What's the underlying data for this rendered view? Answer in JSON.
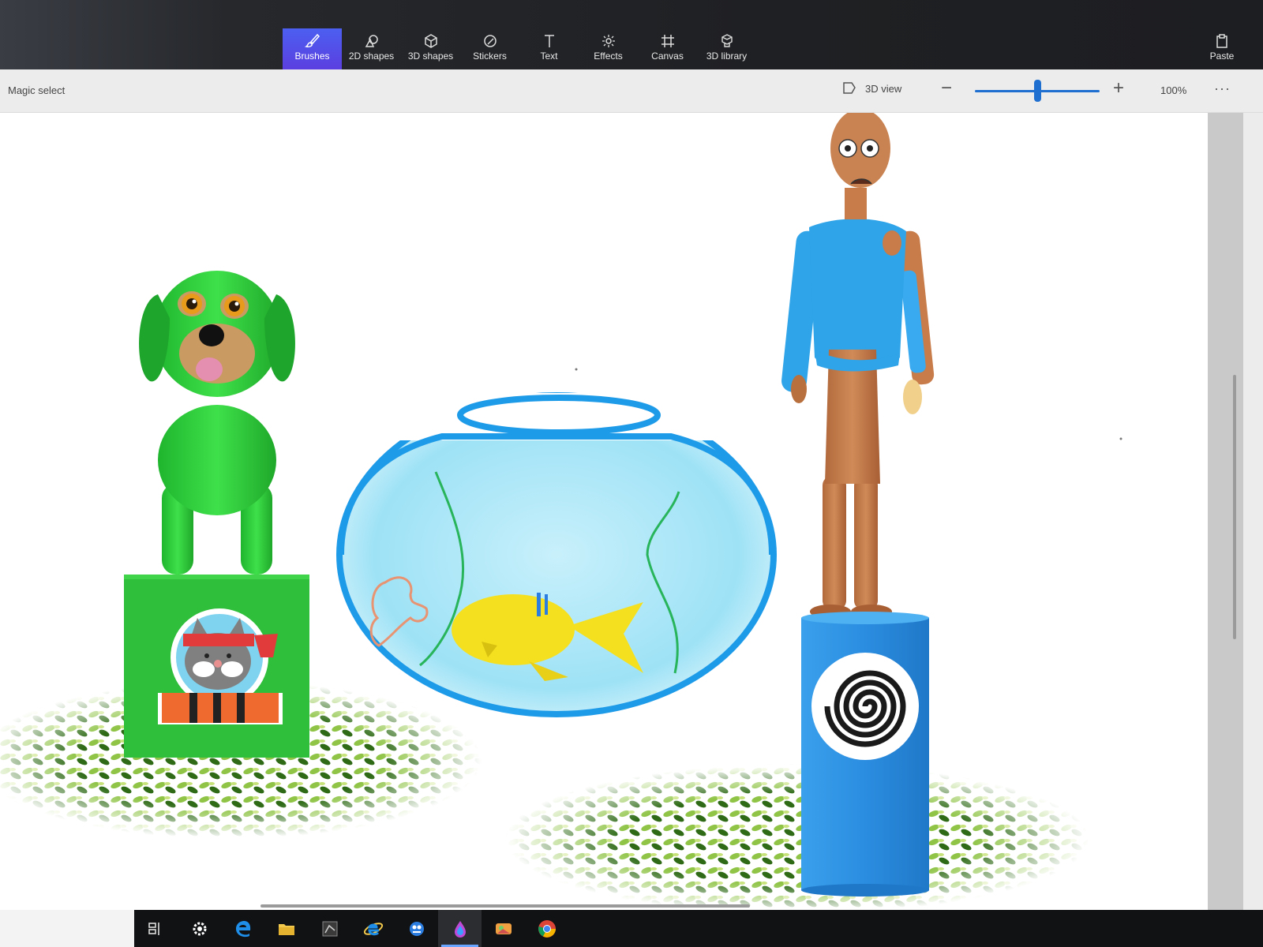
{
  "toolbar": {
    "tools": [
      {
        "label": "Brushes",
        "icon": "brush-icon"
      },
      {
        "label": "2D shapes",
        "icon": "2d-shapes-icon"
      },
      {
        "label": "3D shapes",
        "icon": "3d-shapes-icon"
      },
      {
        "label": "Stickers",
        "icon": "stickers-icon"
      },
      {
        "label": "Text",
        "icon": "text-icon"
      },
      {
        "label": "Effects",
        "icon": "effects-icon"
      },
      {
        "label": "Canvas",
        "icon": "canvas-icon"
      },
      {
        "label": "3D library",
        "icon": "3d-library-icon"
      }
    ],
    "active_tool": "Brushes",
    "paste_label": "Paste"
  },
  "subbar": {
    "magic_select_label": "Magic select",
    "view_3d_label": "3D view",
    "zoom_minus": "−",
    "zoom_plus": "+",
    "zoom_value": "100%",
    "zoom_level_fraction": 0.5,
    "more_label": "···"
  },
  "canvas": {
    "objects": [
      "green-dog",
      "cat-sticker-cube",
      "fish-bowl",
      "yellow-fish",
      "standing-man",
      "spiral-cylinder",
      "grass-patch"
    ]
  },
  "colors": {
    "accent": "#4c5ff0",
    "dog_green": "#2ecc40",
    "bowl_blue": "#1e9be8",
    "cylinder_blue": "#2e8fe0",
    "fish_yellow": "#f5e020"
  },
  "taskbar": {
    "icons": [
      "task-view-icon",
      "settings-icon",
      "edge-icon",
      "file-explorer-icon",
      "app-icon",
      "internet-explorer-icon",
      "paint-bug-icon",
      "paint-3d-icon",
      "photos-icon",
      "chrome-icon"
    ],
    "active": "paint-3d-icon"
  }
}
